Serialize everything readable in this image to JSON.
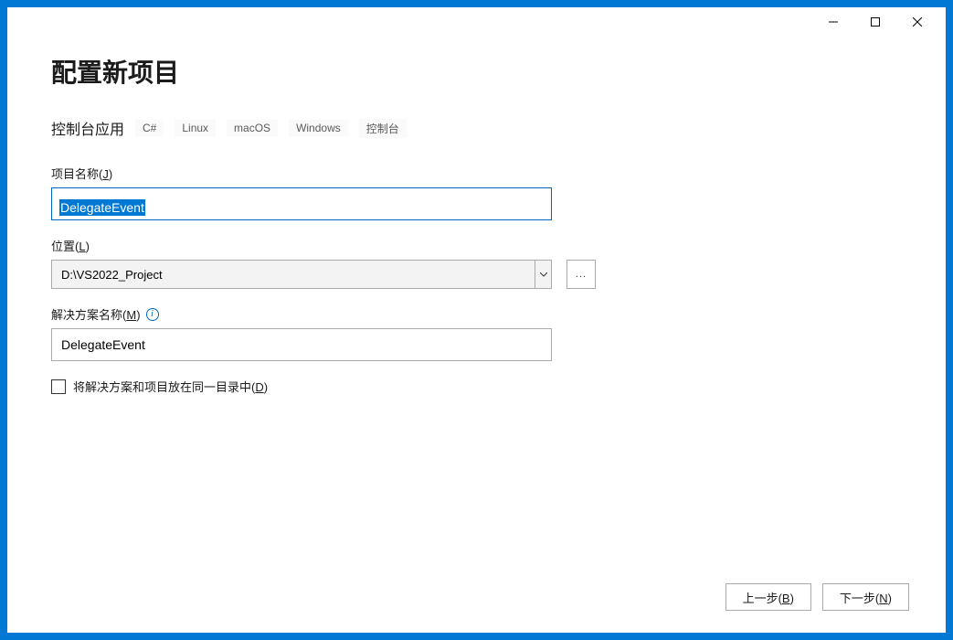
{
  "window": {
    "title": "配置新项目"
  },
  "templateRow": {
    "name": "控制台应用",
    "tags": [
      "C#",
      "Linux",
      "macOS",
      "Windows",
      "控制台"
    ]
  },
  "fields": {
    "projectName": {
      "label_prefix": "项目名称(",
      "label_key": "J",
      "label_suffix": ")",
      "value": "DelegateEvent"
    },
    "location": {
      "label_prefix": "位置(",
      "label_key": "L",
      "label_suffix": ")",
      "value": "D:\\VS2022_Project",
      "browseText": "..."
    },
    "solutionName": {
      "label_prefix": "解决方案名称(",
      "label_key": "M",
      "label_suffix": ")",
      "value": "DelegateEvent"
    },
    "sameDirectory": {
      "label_prefix": "将解决方案和项目放在同一目录中(",
      "label_key": "D",
      "label_suffix": ")",
      "checked": false
    }
  },
  "footer": {
    "back_prefix": "上一步(",
    "back_key": "B",
    "back_suffix": ")",
    "next_prefix": "下一步(",
    "next_key": "N",
    "next_suffix": ")"
  }
}
